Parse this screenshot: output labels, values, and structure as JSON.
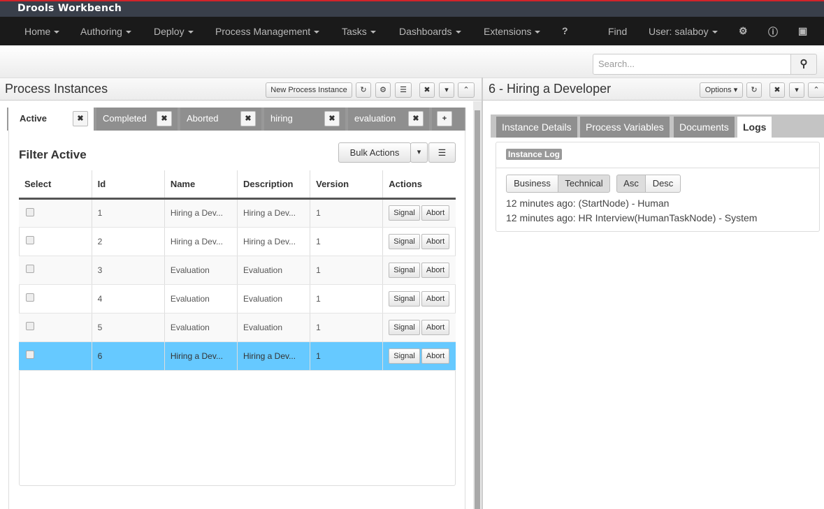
{
  "app": {
    "title": "Drools Workbench"
  },
  "nav": {
    "items": [
      "Home",
      "Authoring",
      "Deploy",
      "Process Management",
      "Tasks",
      "Dashboards",
      "Extensions"
    ],
    "find": "Find",
    "user": "User: salaboy"
  },
  "search": {
    "placeholder": "Search..."
  },
  "left": {
    "title": "Process Instances",
    "new_instance": "New Process Instance",
    "filter_tabs": [
      "Active",
      "Completed",
      "Aborted",
      "hiring",
      "evaluation"
    ],
    "add_tab": "+",
    "filter_title": "Filter Active",
    "bulk_actions": "Bulk Actions",
    "columns": [
      "Select",
      "Id",
      "Name",
      "Description",
      "Version",
      "Actions"
    ],
    "rows": [
      {
        "id": "1",
        "name": "Hiring a Dev...",
        "description": "Hiring a Dev...",
        "version": "1"
      },
      {
        "id": "2",
        "name": "Hiring a Dev...",
        "description": "Hiring a Dev...",
        "version": "1"
      },
      {
        "id": "3",
        "name": "Evaluation",
        "description": "Evaluation",
        "version": "1"
      },
      {
        "id": "4",
        "name": "Evaluation",
        "description": "Evaluation",
        "version": "1"
      },
      {
        "id": "5",
        "name": "Evaluation",
        "description": "Evaluation",
        "version": "1"
      },
      {
        "id": "6",
        "name": "Hiring a Dev...",
        "description": "Hiring a Dev...",
        "version": "1",
        "selected": true
      }
    ],
    "signal": "Signal",
    "abort": "Abort"
  },
  "right": {
    "title": "6 - Hiring a Developer",
    "options": "Options",
    "tabs": [
      "Instance Details",
      "Process Variables",
      "Documents",
      "Logs"
    ],
    "active_tab": "Logs",
    "log_label": "Instance Log",
    "toggles": {
      "business": "Business",
      "technical": "Technical",
      "asc": "Asc",
      "desc": "Desc"
    },
    "log_lines": [
      "12 minutes ago: (StartNode) - Human",
      "12 minutes ago: HR Interview(HumanTaskNode) - System"
    ]
  },
  "colors": {
    "accent_red": "#d1232a",
    "selected_row": "#66c9ff"
  }
}
